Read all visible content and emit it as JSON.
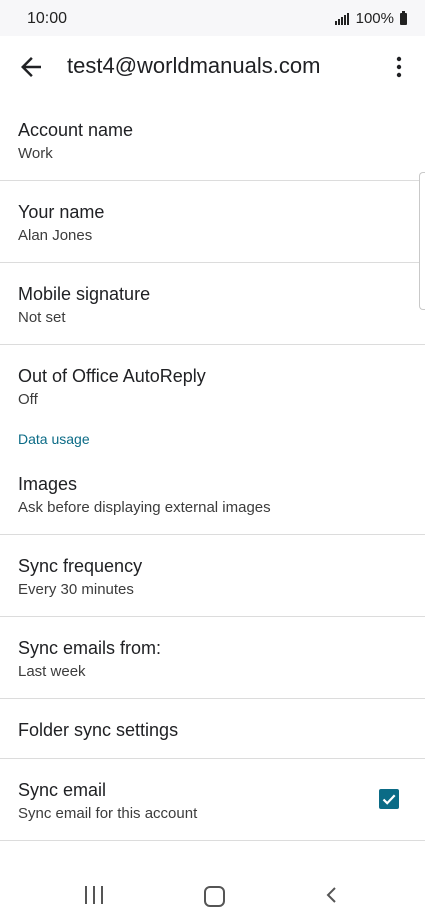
{
  "status_bar": {
    "time": "10:00",
    "battery": "100%"
  },
  "app_bar": {
    "title": "test4@worldmanuals.com"
  },
  "settings": [
    {
      "primary": "Account name",
      "secondary": "Work"
    },
    {
      "primary": "Your name",
      "secondary": "Alan Jones"
    },
    {
      "primary": "Mobile signature",
      "secondary": "Not set"
    },
    {
      "primary": "Out of Office AutoReply",
      "secondary": "Off"
    }
  ],
  "data_usage": {
    "header": "Data usage",
    "items": [
      {
        "primary": "Images",
        "secondary": "Ask before displaying external images"
      },
      {
        "primary": "Sync frequency",
        "secondary": "Every 30 minutes"
      },
      {
        "primary": "Sync emails from:",
        "secondary": "Last week"
      },
      {
        "primary": "Folder sync settings"
      },
      {
        "primary": "Sync email",
        "secondary": "Sync email for this account",
        "checked": true
      }
    ]
  },
  "colors": {
    "accent": "#0b6b86",
    "divider": "#dcdcdc"
  },
  "icons": {
    "back": "arrow-left-icon",
    "more": "more-vert-icon",
    "nav_recent": "recent-apps-icon",
    "nav_home": "home-icon",
    "nav_back": "chevron-left-icon"
  }
}
